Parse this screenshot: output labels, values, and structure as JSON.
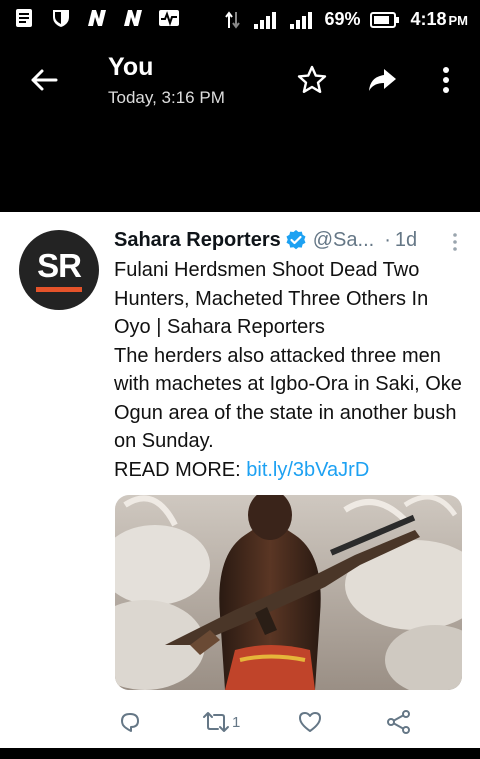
{
  "status_bar": {
    "battery": "69%",
    "time": "4:18",
    "ampm": "PM",
    "left_icons": [
      "notes-icon",
      "shield-icon",
      "n-app-icon",
      "n-app-icon",
      "activity-icon"
    ],
    "right_icons": [
      "data-arrows-icon",
      "signal-icon",
      "signal-icon",
      "battery-icon"
    ]
  },
  "header": {
    "title": "You",
    "subtitle": "Today, 3:16 PM"
  },
  "tweet": {
    "author_name": "Sahara Reporters",
    "avatar_text": "SR",
    "handle": "@Sa...",
    "separator": "·",
    "time": "1d",
    "headline": "Fulani Herdsmen Shoot Dead Two Hunters, Macheted Three Others In Oyo | Sahara Reporters",
    "body": "The herders also attacked three men with machetes at Igbo-Ora in Saki, Oke Ogun area of the state in another bush on Sunday.",
    "read_more_label": "READ MORE:",
    "link_text": "bit.ly/3bVaJrD",
    "retweet_count": "1"
  },
  "colors": {
    "link": "#1da1f2",
    "verified": "#1da1f2",
    "avatar_accent": "#e5532a",
    "secondary_text": "#657786"
  }
}
